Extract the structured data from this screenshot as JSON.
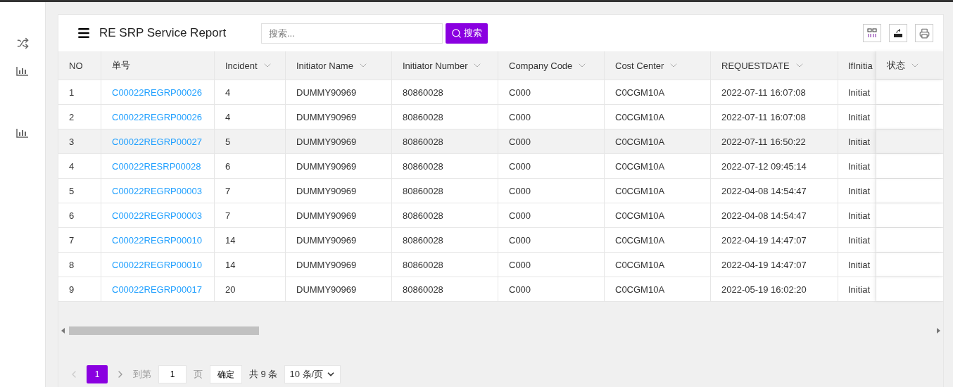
{
  "header": {
    "title": "RE SRP Service Report",
    "search": {
      "placeholder": "搜索..."
    },
    "search_button": "搜索"
  },
  "table": {
    "columns": [
      "NO",
      "单号",
      "Incident",
      "Initiator Name",
      "Initiator Number",
      "Company Code",
      "Cost Center",
      "REQUESTDATE",
      "IfInitia",
      "状态"
    ],
    "sortable": [
      false,
      false,
      true,
      true,
      true,
      true,
      true,
      true,
      false,
      true
    ],
    "rows": [
      {
        "no": "1",
        "id": "C00022REGRP00026",
        "incident": "4",
        "initiator_name": "DUMMY90969",
        "initiator_number": "80860028",
        "company_code": "C000",
        "cost_center": "C0CGM10A",
        "request_date": "2022-07-11 16:07:08",
        "if_initia": "Initiat",
        "highlighted": false
      },
      {
        "no": "2",
        "id": "C00022REGRP00026",
        "incident": "4",
        "initiator_name": "DUMMY90969",
        "initiator_number": "80860028",
        "company_code": "C000",
        "cost_center": "C0CGM10A",
        "request_date": "2022-07-11 16:07:08",
        "if_initia": "Initiat",
        "highlighted": false
      },
      {
        "no": "3",
        "id": "C00022REGRP00027",
        "incident": "5",
        "initiator_name": "DUMMY90969",
        "initiator_number": "80860028",
        "company_code": "C000",
        "cost_center": "C0CGM10A",
        "request_date": "2022-07-11 16:50:22",
        "if_initia": "Initiat",
        "highlighted": true
      },
      {
        "no": "4",
        "id": "C00022RESRP00028",
        "incident": "6",
        "initiator_name": "DUMMY90969",
        "initiator_number": "80860028",
        "company_code": "C000",
        "cost_center": "C0CGM10A",
        "request_date": "2022-07-12 09:45:14",
        "if_initia": "Initiat",
        "highlighted": false
      },
      {
        "no": "5",
        "id": "C00022REGRP00003",
        "incident": "7",
        "initiator_name": "DUMMY90969",
        "initiator_number": "80860028",
        "company_code": "C000",
        "cost_center": "C0CGM10A",
        "request_date": "2022-04-08 14:54:47",
        "if_initia": "Initiat",
        "highlighted": false
      },
      {
        "no": "6",
        "id": "C00022REGRP00003",
        "incident": "7",
        "initiator_name": "DUMMY90969",
        "initiator_number": "80860028",
        "company_code": "C000",
        "cost_center": "C0CGM10A",
        "request_date": "2022-04-08 14:54:47",
        "if_initia": "Initiat",
        "highlighted": false
      },
      {
        "no": "7",
        "id": "C00022REGRP00010",
        "incident": "14",
        "initiator_name": "DUMMY90969",
        "initiator_number": "80860028",
        "company_code": "C000",
        "cost_center": "C0CGM10A",
        "request_date": "2022-04-19 14:47:07",
        "if_initia": "Initiat",
        "highlighted": false
      },
      {
        "no": "8",
        "id": "C00022REGRP00010",
        "incident": "14",
        "initiator_name": "DUMMY90969",
        "initiator_number": "80860028",
        "company_code": "C000",
        "cost_center": "C0CGM10A",
        "request_date": "2022-04-19 14:47:07",
        "if_initia": "Initiat",
        "highlighted": false
      },
      {
        "no": "9",
        "id": "C00022REGRP00017",
        "incident": "20",
        "initiator_name": "DUMMY90969",
        "initiator_number": "80860028",
        "company_code": "C000",
        "cost_center": "C0CGM10A",
        "request_date": "2022-05-19 16:02:20",
        "if_initia": "Initiat",
        "highlighted": false
      }
    ]
  },
  "pagination": {
    "prev_disabled": true,
    "pages": [
      {
        "label": "1",
        "selected": true
      }
    ],
    "goto_label": "到第",
    "goto_value": "1",
    "page_unit": "页",
    "confirm": "确定",
    "total": "共 9 条",
    "page_size": "10 条/页"
  }
}
